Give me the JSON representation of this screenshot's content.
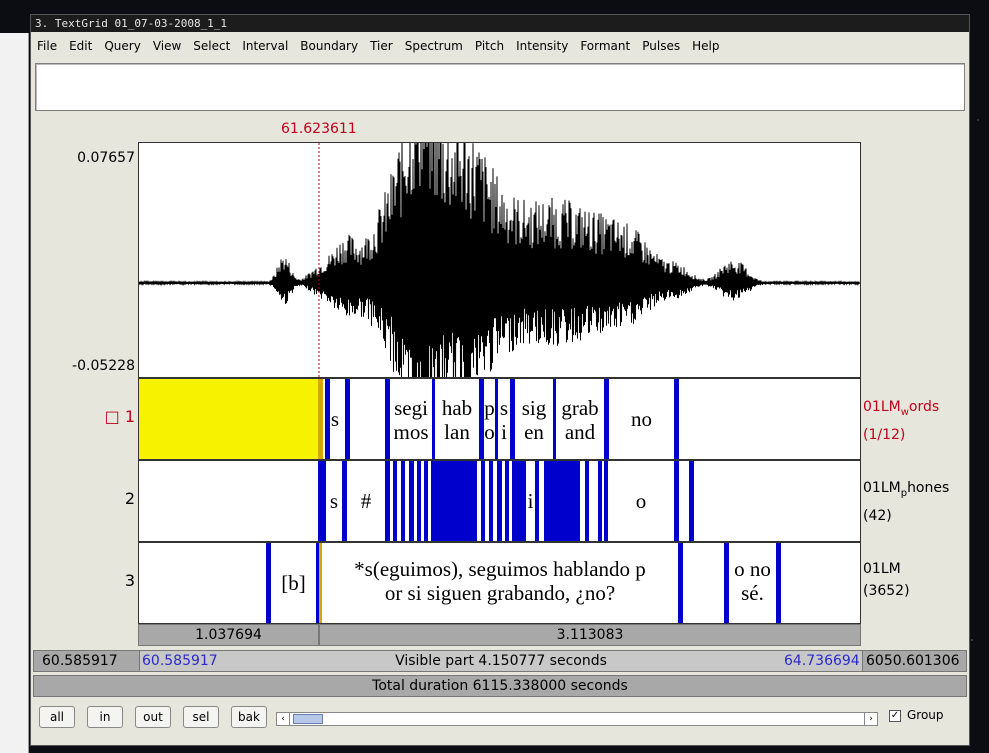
{
  "window": {
    "title": "3. TextGrid 01_07-03-2008_1_1"
  },
  "menu": [
    "File",
    "Edit",
    "Query",
    "View",
    "Select",
    "Interval",
    "Boundary",
    "Tier",
    "Spectrum",
    "Pitch",
    "Intensity",
    "Formant",
    "Pulses",
    "Help"
  ],
  "text_field_value": "",
  "cursor_time": "61.623611",
  "waveform": {
    "y_max": "0.07657",
    "y_min": "-0.05228"
  },
  "tiers": [
    {
      "number": "1",
      "selected_marker": "□",
      "name": "01LMwords",
      "name_main": "01LM",
      "name_sub": "w",
      "name_rest": "ords",
      "count": "(1/12)",
      "labels": [
        "s",
        "segi\nmos",
        "hab\nlan",
        "p\no",
        "s\ni",
        "sig\nen",
        "grab\nand",
        "no"
      ]
    },
    {
      "number": "2",
      "name": "01LMphones",
      "name_main": "01LM",
      "name_sub": "p",
      "name_rest": "hones",
      "count": "(42)",
      "labels": [
        "s",
        "#",
        "i",
        "o"
      ]
    },
    {
      "number": "3",
      "name": "01LM",
      "count": "(3652)",
      "labels": [
        "[b]",
        "*s(eguimos), seguimos hablando p\nor si siguen grabando, ¿no?",
        "o no\nsé."
      ]
    }
  ],
  "durations": {
    "left": "1.037694",
    "right": "3.113083"
  },
  "visible": {
    "start_outer": "60.585917",
    "start": "60.585917",
    "label": "Visible part 4.150777 seconds",
    "end": "64.736694",
    "end_outer": "6050.601306"
  },
  "total": "Total duration 6115.338000 seconds",
  "buttons": {
    "all": "all",
    "in": "in",
    "out": "out",
    "sel": "sel",
    "bak": "bak"
  },
  "group": {
    "label": "Group",
    "checked": true
  },
  "colors": {
    "selection": "#f7f300",
    "boundary": "#0000cc",
    "cursor": "#c0001a"
  }
}
